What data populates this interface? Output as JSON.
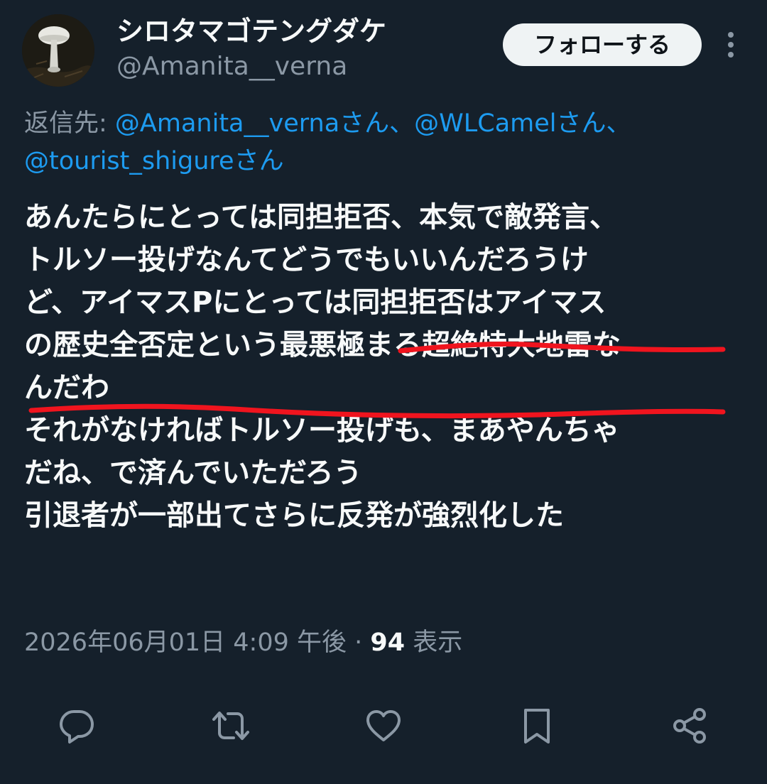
{
  "author": {
    "display_name": "シロタマゴテングダケ",
    "handle": "@Amanita__verna",
    "avatar_icon": "mushroom-avatar"
  },
  "follow_button_label": "フォローする",
  "more_icon": "more-vertical-icon",
  "reply_context": {
    "prefix": "返信先: ",
    "mention_1": "@Amanita__vernaさん",
    "sep_1": "、",
    "mention_2": "@WLCamelさん",
    "sep_2": "、",
    "mention_3": "@tourist_shigureさん"
  },
  "tweet_lines": [
    "あんたらにとっては同担拒否、本気で敵発言、",
    "トルソー投げなんてどうでもいいんだろうけ",
    "ど、アイマスPにとっては同担拒否はアイマス",
    "の歴史全否定という最悪極まる超絶特大地雷な",
    "んだわ",
    "それがなければトルソー投げも、まあやんちゃ",
    "だね、で済んでいただろう",
    "引退者が一部出てさらに反発が強烈化した"
  ],
  "highlight_color": "#f0141e",
  "timestamp": "2026年06月01日 4:09 午後",
  "separator": " · ",
  "views": {
    "count": "94",
    "label": " 表示"
  },
  "actions": [
    {
      "name": "reply",
      "icon": "reply-icon"
    },
    {
      "name": "retweet",
      "icon": "retweet-icon"
    },
    {
      "name": "like",
      "icon": "like-icon"
    },
    {
      "name": "bookmark",
      "icon": "bookmark-icon"
    },
    {
      "name": "share",
      "icon": "share-icon"
    }
  ]
}
